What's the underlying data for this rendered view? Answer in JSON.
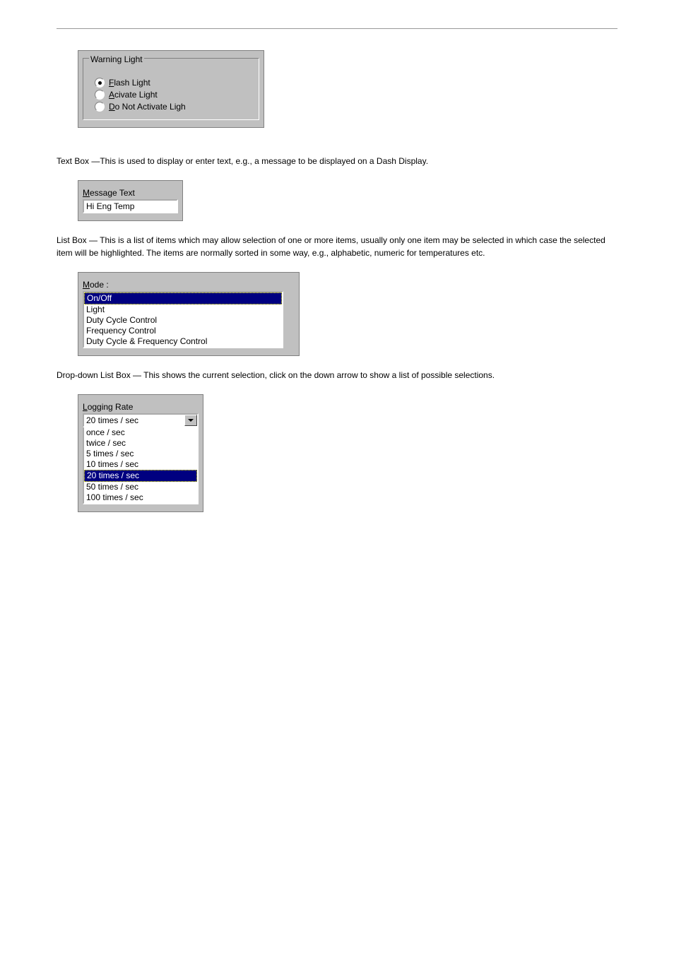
{
  "warning_light": {
    "legend": "Warning Light",
    "options": [
      {
        "label": "Flash Light",
        "ul": "F",
        "rest": "lash Light",
        "selected": true
      },
      {
        "label": "Acivate Light",
        "ul": "A",
        "rest": "civate Light",
        "selected": false
      },
      {
        "label": "Do Not Activate Light",
        "ul": "D",
        "rest": "o Not Activate Ligh",
        "selected": false
      }
    ]
  },
  "p1": "Text Box —This is used to display or enter text, e.g., a message to be displayed on a Dash Display.",
  "msg": {
    "label_ul": "M",
    "label_rest": "essage Text",
    "value": "Hi Eng Temp"
  },
  "p2": "List Box — This is a list of items which may allow selection of one or more items, usually only one item may be selected in which case the selected item will be highlighted. The items are normally sorted in some way, e.g., alphabetic, numeric for temperatures etc.",
  "mode": {
    "label_ul": "M",
    "label_rest": "ode :",
    "items": [
      "On/Off",
      "Light",
      "Duty Cycle Control",
      "Frequency Control",
      "Duty Cycle & Frequency Control"
    ],
    "selected_index": 0
  },
  "p3": "Drop-down List Box — This shows the current selection, click on the down arrow to show a list of possible selections.",
  "logging": {
    "label_ul": "L",
    "label_rest": "ogging Rate",
    "current": "20 times / sec",
    "options": [
      "once / sec",
      "twice / sec",
      "5 times / sec",
      "10 times / sec",
      "20 times / sec",
      "50 times / sec",
      "100 times / sec"
    ],
    "selected_index": 4
  }
}
